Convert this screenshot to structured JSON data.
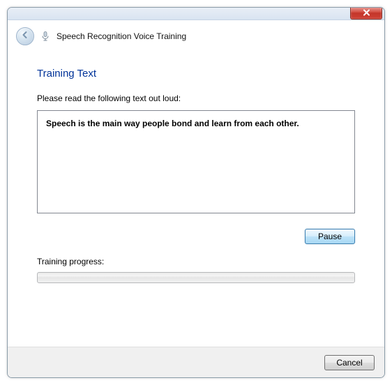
{
  "window": {
    "title": "Speech Recognition Voice Training"
  },
  "content": {
    "section_title": "Training Text",
    "instruction": "Please read the following text out loud:",
    "training_text": "Speech is the main way people bond and learn from each other.",
    "pause_label": "Pause",
    "progress_label": "Training progress:"
  },
  "footer": {
    "cancel_label": "Cancel"
  }
}
